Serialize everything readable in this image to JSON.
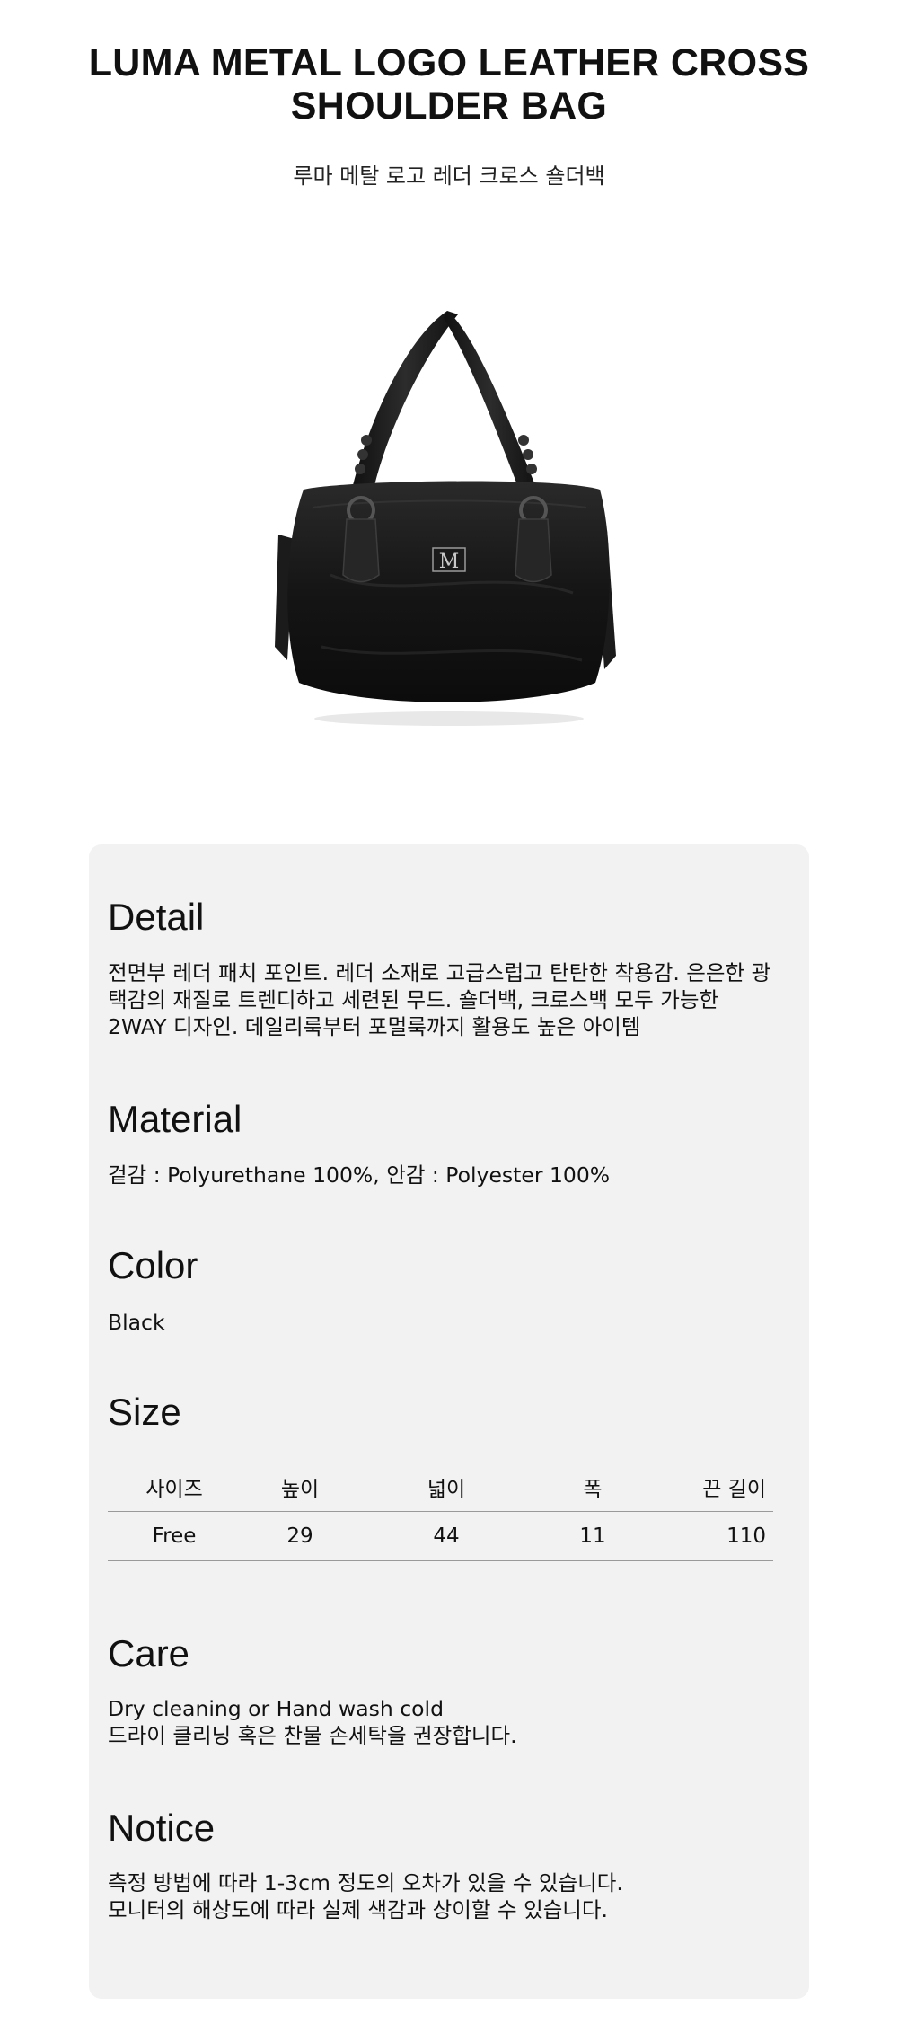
{
  "product": {
    "title_line1": "LUMA METAL LOGO LEATHER CROSS",
    "title_line2": "SHOULDER BAG",
    "subtitle": "루마 메탈 로고 레더 크로스 숄더백",
    "image_icon": "black-leather-shoulder-bag-photo"
  },
  "detail": {
    "heading": "Detail",
    "lines": [
      "전면부 레더 패치 포인트. 레더 소재로 고급스럽고 탄탄한 착용감. 은은한 광",
      "택감의 재질로 트렌디하고 세련된 무드. 숄더백, 크로스백 모두 가능한",
      "2WAY 디자인. 데일리룩부터 포멀룩까지 활용도 높은 아이템"
    ]
  },
  "material": {
    "heading": "Material",
    "text": "겉감 : Polyurethane 100%, 안감 : Polyester 100%"
  },
  "color": {
    "heading": "Color",
    "text": "Black"
  },
  "size": {
    "heading": "Size",
    "columns": [
      "사이즈",
      "높이",
      "넓이",
      "폭",
      "끈 길이"
    ],
    "rows": [
      [
        "Free",
        "29",
        "44",
        "11",
        "110"
      ]
    ]
  },
  "care": {
    "heading": "Care",
    "lines": [
      "Dry cleaning or Hand wash cold",
      "드라이 클리닝 혹은 찬물 손세탁을 권장합니다."
    ]
  },
  "notice": {
    "heading": "Notice",
    "lines": [
      "측정 방법에 따라 1-3cm 정도의 오차가 있을 수 있습니다.",
      "모니터의 해상도에 따라 실제 색감과 상이할 수 있습니다."
    ]
  },
  "colors": {
    "card_background": "#f2f2f2",
    "text": "#111111",
    "table_rule": "#9a9a9a"
  }
}
